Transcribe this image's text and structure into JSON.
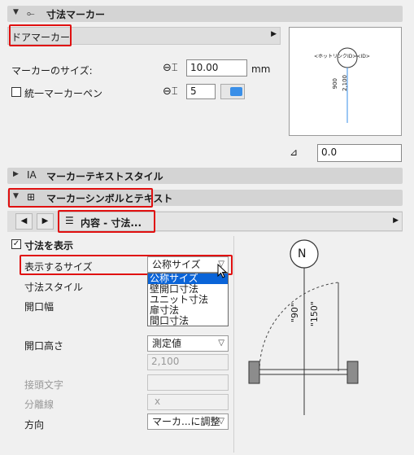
{
  "sections": {
    "marker": {
      "label": "寸法マーカー"
    },
    "text_style": {
      "label": "マーカーテキストスタイル"
    },
    "symbol_text": {
      "label": "マーカーシンボルとテキスト"
    }
  },
  "marker_type": {
    "value": "ドアマーカー"
  },
  "marker_size": {
    "label": "マーカーのサイズ:",
    "value": "10.00",
    "unit": "mm"
  },
  "pen": {
    "label": "統一マーカーペン",
    "checked": false,
    "value": "5",
    "color": "#3a8fe8"
  },
  "preview": {
    "tag_text": "<ホットリンクID><ID>",
    "dim1": "900",
    "dim2": "2,100"
  },
  "angle": {
    "value": "0.0"
  },
  "page": {
    "title": "内容 - 寸法..."
  },
  "show_dims": {
    "label": "寸法を表示",
    "checked": true
  },
  "rows": {
    "display_size": {
      "label": "表示するサイズ",
      "value": "公称サイズ"
    },
    "dim_style": {
      "label": "寸法スタイル"
    },
    "opening_width": {
      "label": "開口幅"
    },
    "opening_height": {
      "label": "開口高さ",
      "value": "測定値",
      "sub_value": "2,100"
    },
    "prefix": {
      "label": "接頭文字"
    },
    "separator": {
      "label": "分離線",
      "value": "x"
    },
    "direction": {
      "label": "方向",
      "value": "マーカ...に調整"
    }
  },
  "dropdown_options": [
    "公称サイズ",
    "壁開口寸法",
    "ユニット寸法",
    "扉寸法",
    "間口寸法"
  ],
  "diagram": {
    "north": "N",
    "dim_a": "\"90\"",
    "dim_b": "\"150\""
  }
}
